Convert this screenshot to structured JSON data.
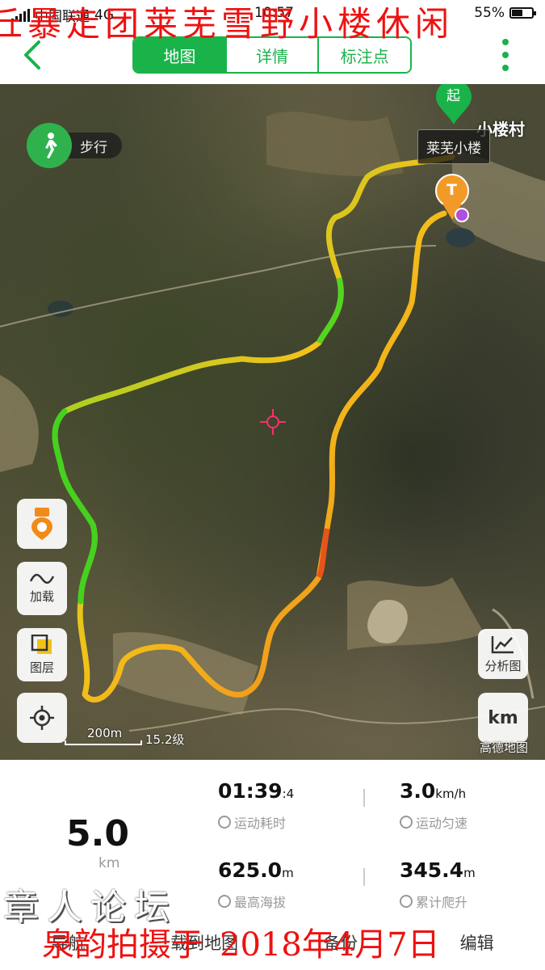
{
  "status_bar": {
    "carrier": "中国联通",
    "network": "4G",
    "time": "10:57",
    "battery": "55%",
    "battery_level": 0.55
  },
  "overlay_title": "丘暴走团莱芜雪野小楼休闲",
  "nav": {
    "tabs": [
      {
        "label": "地图",
        "active": true
      },
      {
        "label": "详情",
        "active": false
      },
      {
        "label": "标注点",
        "active": false
      }
    ]
  },
  "map": {
    "mode_label": "步行",
    "start_label": "起",
    "end_marker": "T",
    "place_tooltip": "莱芜小楼",
    "village_label": "小楼村",
    "scale_distance": "200m",
    "zoom_level": "15.2级",
    "provider": "高德地图",
    "buttons": {
      "load": "加载",
      "layers": "图层",
      "analysis": "分析图",
      "unit": "km"
    }
  },
  "stats": {
    "distance_value": "5.0",
    "distance_unit": "km",
    "duration_main": "01:39",
    "duration_sec": ":4",
    "duration_label": "运动耗时",
    "speed_value": "3.0",
    "speed_unit": "km/h",
    "speed_label": "运动匀速",
    "max_alt_value": "625.0",
    "max_alt_unit": "m",
    "max_alt_label": "最高海拔",
    "climb_value": "345.4",
    "climb_unit": "m",
    "climb_label": "累计爬升"
  },
  "bottom_bar": {
    "nav": "导航",
    "load_map": "载到地图",
    "backup": "备份",
    "edit": "编辑"
  },
  "footer_overlay": {
    "photographer": "泉韵拍摄于",
    "date": "2018年4月7日"
  },
  "signature": "章人论坛",
  "colors": {
    "brand_green": "#19b34a",
    "overlay_red": "#e11"
  }
}
